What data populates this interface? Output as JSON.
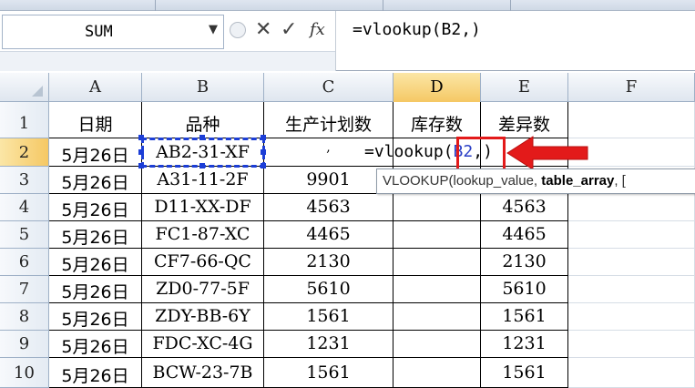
{
  "formula_bar": {
    "name_box": "SUM",
    "cancel_icon": "✕",
    "enter_icon": "✓",
    "fx_label": "fx",
    "content": "=vlookup(B2,)"
  },
  "columns": [
    "A",
    "B",
    "C",
    "D",
    "E",
    "F"
  ],
  "active_column": "D",
  "rows": [
    "1",
    "2",
    "3",
    "4",
    "5",
    "6",
    "7",
    "8",
    "9",
    "10"
  ],
  "active_row": "2",
  "table": {
    "headers": [
      "日期",
      "品种",
      "生产计划数",
      "库存数",
      "差异数"
    ],
    "data": [
      [
        "5月26日",
        "AB2-31-XF",
        "",
        "",
        ""
      ],
      [
        "5月26日",
        "A31-11-2F",
        "9901",
        "",
        ""
      ],
      [
        "5月26日",
        "D11-XX-DF",
        "4563",
        "",
        "4563"
      ],
      [
        "5月26日",
        "FC1-87-XC",
        "4465",
        "",
        "4465"
      ],
      [
        "5月26日",
        "CF7-66-QC",
        "2130",
        "",
        "2130"
      ],
      [
        "5月26日",
        "ZD0-77-5F",
        "5610",
        "",
        "5610"
      ],
      [
        "5月26日",
        "ZDY-BB-6Y",
        "1561",
        "",
        "1561"
      ],
      [
        "5月26日",
        "FDC-XC-4G",
        "1231",
        "",
        "1231"
      ],
      [
        "5月26日",
        "BCW-23-7B",
        "1561",
        "",
        "1561"
      ]
    ]
  },
  "c2_partial": ",",
  "inline_formula": {
    "prefix": "=vlookup(",
    "ref": "B2",
    "suffix": ",)"
  },
  "tooltip": {
    "func": "VLOOKUP(",
    "arg1": "lookup_value, ",
    "arg2": "table_array",
    "rest": ", ["
  },
  "colors": {
    "selection": "#1c3ed6",
    "annotation_red": "#e31a1a",
    "active_header": "#f5c864"
  }
}
